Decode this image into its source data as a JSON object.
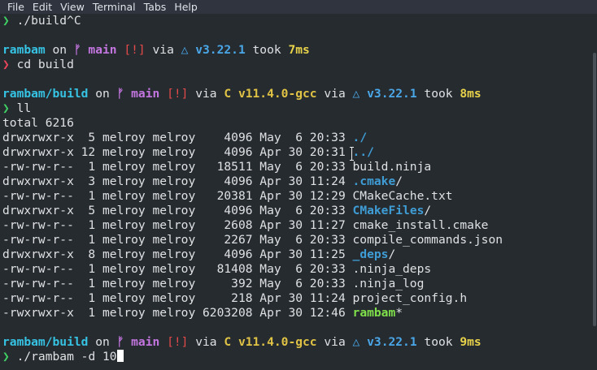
{
  "menu": [
    "File",
    "Edit",
    "View",
    "Terminal",
    "Tabs",
    "Help"
  ],
  "colors": {
    "background": "#262b30",
    "foreground": "#dfe1e3",
    "prompt_arrow": "#3fcf63",
    "prompt_arrow_error": "#e8455a",
    "path": "#36c3e3",
    "branch": "#c476e0",
    "status": "#e34a4a",
    "version": "#4aa7e8",
    "c_version": "#e0c344",
    "duration": "#e8d34a",
    "directory": "#3f9dd6",
    "executable": "#7fe04a"
  },
  "lines": [
    [
      {
        "t": "❯ ",
        "c": "prompt_arrow"
      },
      {
        "t": "./build^C"
      }
    ],
    [
      {
        "t": ""
      }
    ],
    [
      {
        "t": "rambam",
        "c": "path",
        "b": true
      },
      {
        "t": " on "
      },
      {
        "t": "ᚠ main",
        "c": "branch",
        "b": true
      },
      {
        "t": " "
      },
      {
        "t": "[!]",
        "c": "status"
      },
      {
        "t": " via "
      },
      {
        "t": "△ v3.22.1",
        "c": "version",
        "b": true
      },
      {
        "t": " took "
      },
      {
        "t": "7ms",
        "c": "duration",
        "b": true
      }
    ],
    [
      {
        "t": "❯ ",
        "c": "prompt_arrow_error"
      },
      {
        "t": "cd build"
      }
    ],
    [
      {
        "t": ""
      }
    ],
    [
      {
        "t": "rambam/build",
        "c": "path",
        "b": true
      },
      {
        "t": " on "
      },
      {
        "t": "ᚠ main",
        "c": "branch",
        "b": true
      },
      {
        "t": " "
      },
      {
        "t": "[!]",
        "c": "status"
      },
      {
        "t": " via "
      },
      {
        "t": "C v11.4.0-gcc",
        "c": "c_version",
        "b": true
      },
      {
        "t": " via "
      },
      {
        "t": "△ v3.22.1",
        "c": "version",
        "b": true
      },
      {
        "t": " took "
      },
      {
        "t": "8ms",
        "c": "duration",
        "b": true
      }
    ],
    [
      {
        "t": "❯ ",
        "c": "prompt_arrow"
      },
      {
        "t": "ll"
      }
    ],
    [
      {
        "t": "total 6216"
      }
    ],
    [
      {
        "t": "drwxrwxr-x  5 melroy melroy    4096 May  6 20:33 "
      },
      {
        "t": "./",
        "c": "directory",
        "b": true
      }
    ],
    [
      {
        "t": "drwxrwxr-x 12 melroy melroy    4096 Apr 30 20:31 "
      },
      {
        "t": "../",
        "c": "directory",
        "b": true
      }
    ],
    [
      {
        "t": "-rw-rw-r--  1 melroy melroy   18511 May  6 20:33 build.ninja"
      }
    ],
    [
      {
        "t": "drwxrwxr-x  3 melroy melroy    4096 Apr 30 11:24 "
      },
      {
        "t": ".cmake",
        "c": "directory",
        "b": true
      },
      {
        "t": "/"
      }
    ],
    [
      {
        "t": "-rw-rw-r--  1 melroy melroy   20381 Apr 30 12:29 CMakeCache.txt"
      }
    ],
    [
      {
        "t": "drwxrwxr-x  5 melroy melroy    4096 May  6 20:33 "
      },
      {
        "t": "CMakeFiles",
        "c": "directory",
        "b": true
      },
      {
        "t": "/"
      }
    ],
    [
      {
        "t": "-rw-rw-r--  1 melroy melroy    2608 Apr 30 11:27 cmake_install.cmake"
      }
    ],
    [
      {
        "t": "-rw-rw-r--  1 melroy melroy    2267 May  6 20:33 compile_commands.json"
      }
    ],
    [
      {
        "t": "drwxrwxr-x  8 melroy melroy    4096 Apr 30 11:25 "
      },
      {
        "t": "_deps",
        "c": "directory",
        "b": true
      },
      {
        "t": "/"
      }
    ],
    [
      {
        "t": "-rw-rw-r--  1 melroy melroy   81408 May  6 20:33 .ninja_deps"
      }
    ],
    [
      {
        "t": "-rw-rw-r--  1 melroy melroy     392 May  6 20:33 .ninja_log"
      }
    ],
    [
      {
        "t": "-rw-rw-r--  1 melroy melroy     218 Apr 30 11:24 project_config.h"
      }
    ],
    [
      {
        "t": "-rwxrwxr-x  1 melroy melroy 6203208 Apr 30 12:46 "
      },
      {
        "t": "rambam",
        "c": "executable",
        "b": true
      },
      {
        "t": "*"
      }
    ],
    [
      {
        "t": ""
      }
    ],
    [
      {
        "t": "rambam/build",
        "c": "path",
        "b": true
      },
      {
        "t": " on "
      },
      {
        "t": "ᚠ main",
        "c": "branch",
        "b": true
      },
      {
        "t": " "
      },
      {
        "t": "[!]",
        "c": "status"
      },
      {
        "t": " via "
      },
      {
        "t": "C v11.4.0-gcc",
        "c": "c_version",
        "b": true
      },
      {
        "t": " via "
      },
      {
        "t": "△ v3.22.1",
        "c": "version",
        "b": true
      },
      {
        "t": " took "
      },
      {
        "t": "9ms",
        "c": "duration",
        "b": true
      }
    ],
    [
      {
        "t": "❯ ",
        "c": "prompt_arrow"
      },
      {
        "t": "./rambam -d 10"
      },
      {
        "cursor": true
      }
    ]
  ]
}
